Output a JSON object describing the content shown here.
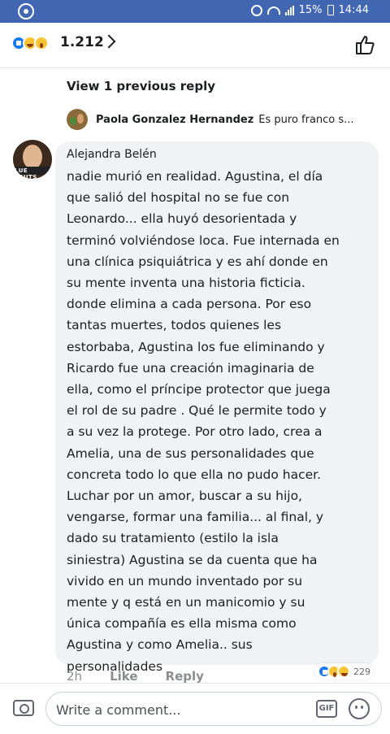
{
  "status_bar": {
    "battery": "15%",
    "time": "14:44"
  },
  "header": {
    "reaction_count": "1.212",
    "reaction_icons": [
      "like-icon",
      "haha-icon",
      "wow-icon"
    ]
  },
  "thread": {
    "view_previous": "View 1 previous reply",
    "previous_reply": {
      "author": "Paola Gonzalez Hernandez",
      "snippet": "Es puro franco s..."
    }
  },
  "comment": {
    "author": "Alejandra Belén",
    "avatar_caption": "LUE TSUTS",
    "lines": [
      "nadie murió en realidad. Agustina, el día",
      "que salió del hospital no se fue con",
      "Leonardo... ella huyó desorientada y",
      "terminó volviéndose loca. Fue internada en",
      "una clínica psiquiátrica y es ahí donde en",
      "su mente inventa una historia ficticia.",
      "donde elimina a cada persona. Por eso",
      "tantas muertes, todos quienes les",
      "estorbaba, Agustina los fue eliminando y",
      "Ricardo fue una creación imaginaria de",
      "ella, como el príncipe protector que juega",
      "el rol de su padre . Qué le permite todo y",
      "a su vez la protege. Por otro lado, crea a",
      "Amelia, una de sus personalidades que",
      "concreta todo lo que ella no pudo hacer.",
      "Luchar por un amor, buscar a su hijo,",
      "vengarse, formar una familia... al final, y",
      "dado su tratamiento (estilo la isla",
      "siniestra) Agustina se da cuenta que ha",
      "vivido en un mundo inventado por su",
      "mente y q está en un manicomio y su",
      "única compañía es ella misma como",
      "Agustina y como Amelia.. sus",
      "personalidades"
    ],
    "time": "2h",
    "like_label": "Like",
    "reply_label": "Reply",
    "reaction_count": "229"
  },
  "composer": {
    "placeholder": "Write a comment...",
    "gif_label": "GIF"
  }
}
